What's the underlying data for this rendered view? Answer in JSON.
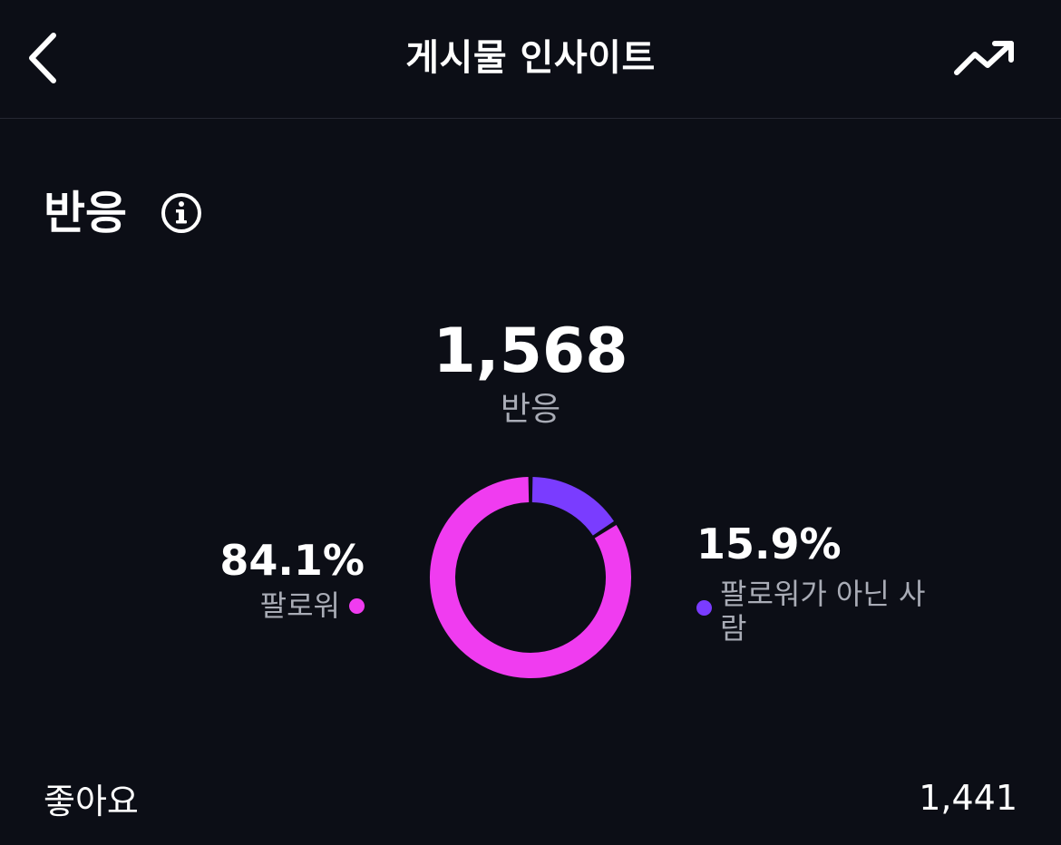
{
  "header": {
    "title": "게시물 인사이트",
    "back_icon": "chevron-left-icon",
    "trend_icon": "trending-up-icon"
  },
  "section": {
    "title": "반응",
    "info_icon": "info-icon"
  },
  "summary": {
    "total": "1,568",
    "label": "반응"
  },
  "breakdown": {
    "followers": {
      "percent": "84.1%",
      "label": "팔로워",
      "value": 84.1,
      "color": "#f03cf0"
    },
    "non_followers": {
      "percent": "15.9%",
      "label": "팔로워가 아닌 사람",
      "value": 15.9,
      "color": "#7a3cff"
    }
  },
  "stats": [
    {
      "label": "좋아요",
      "value": "1,441"
    }
  ]
}
